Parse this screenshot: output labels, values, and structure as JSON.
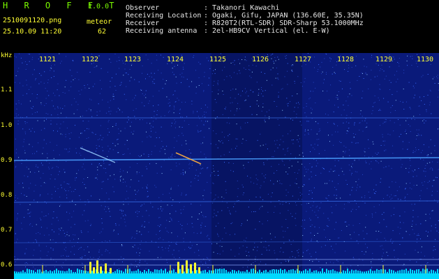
{
  "app": {
    "name": "HROFFT",
    "version": "1.0.0"
  },
  "file": {
    "name": "2510091120.png",
    "datetime": "25.10.09 11:20"
  },
  "meteor": {
    "label": "meteor",
    "count": "62"
  },
  "info": {
    "labels": [
      "Observer",
      "Receiving Location",
      "Receiver",
      "Receiving antenna"
    ],
    "values": [
      ": Takanori Kawachi",
      ": Ogaki, Gifu, JAPAN (136.60E, 35.35N)",
      ": R820T2(RTL-SDR) SDR-Sharp 53.1000MHz",
      ": 2el-HB9CV Vertical (el. E-W)"
    ]
  },
  "axes": {
    "y_unit": "kHz",
    "y_ticks": [
      "1.1",
      "1.0",
      "0.9",
      "0.8",
      "0.7",
      "0.6"
    ],
    "x_ticks": [
      "1121",
      "1122",
      "1123",
      "1124",
      "1125",
      "1126",
      "1127",
      "1128",
      "1129",
      "1130"
    ]
  },
  "colors": {
    "background": "#0a1a7a",
    "noise": "#3a6cff",
    "line": "#4aa0ff",
    "meteor": "#ffd040",
    "bar": "#00d8ff",
    "text_yellow": "#FFFF33",
    "text_green": "#7CFC00"
  }
}
